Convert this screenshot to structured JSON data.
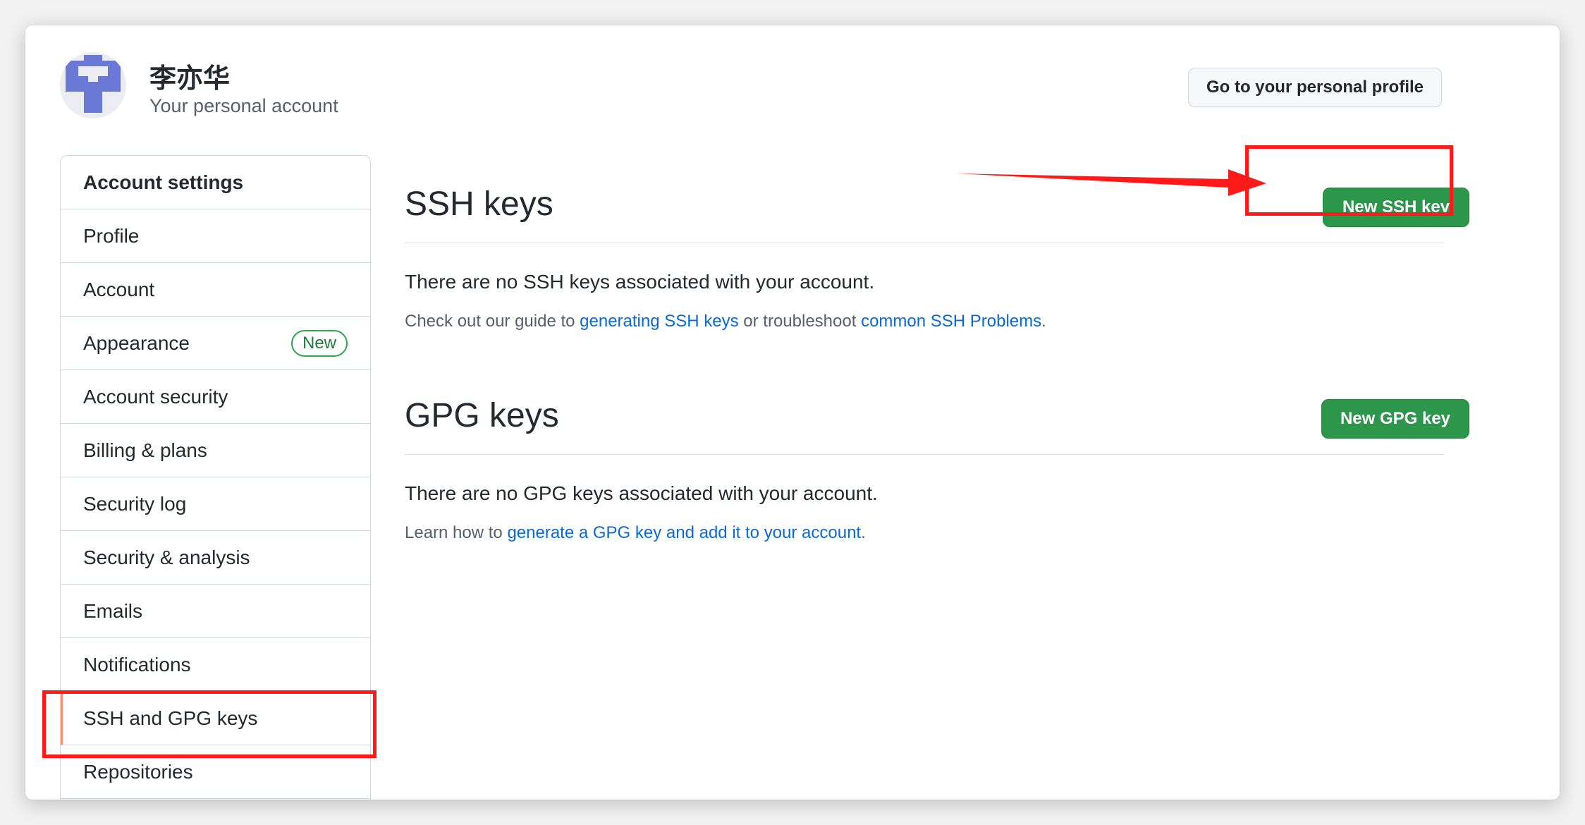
{
  "header": {
    "account_name": "李亦华",
    "account_subtitle": "Your personal account",
    "profile_button": "Go to your personal profile"
  },
  "sidebar": {
    "heading": "Account settings",
    "items": [
      {
        "label": "Profile"
      },
      {
        "label": "Account"
      },
      {
        "label": "Appearance",
        "badge": "New"
      },
      {
        "label": "Account security"
      },
      {
        "label": "Billing & plans"
      },
      {
        "label": "Security log"
      },
      {
        "label": "Security & analysis"
      },
      {
        "label": "Emails"
      },
      {
        "label": "Notifications"
      },
      {
        "label": "SSH and GPG keys",
        "selected": true
      },
      {
        "label": "Repositories"
      }
    ]
  },
  "ssh": {
    "title": "SSH keys",
    "new_button": "New SSH key",
    "blank_text": "There are no SSH keys associated with your account.",
    "help_prefix": "Check out our guide to ",
    "help_link1": "generating SSH keys",
    "help_middle": " or troubleshoot ",
    "help_link2": "common SSH Problems",
    "help_suffix": "."
  },
  "gpg": {
    "title": "GPG keys",
    "new_button": "New GPG key",
    "blank_text": "There are no GPG keys associated with your account.",
    "help_prefix": "Learn how to ",
    "help_link": "generate a GPG key and add it to your account",
    "help_suffix": "."
  },
  "colors": {
    "primary_button": "#2c974b",
    "link": "#0969da",
    "selected_indicator": "#fd8c73",
    "annotation": "#ff1a1a",
    "badge": "#1a7f37"
  }
}
